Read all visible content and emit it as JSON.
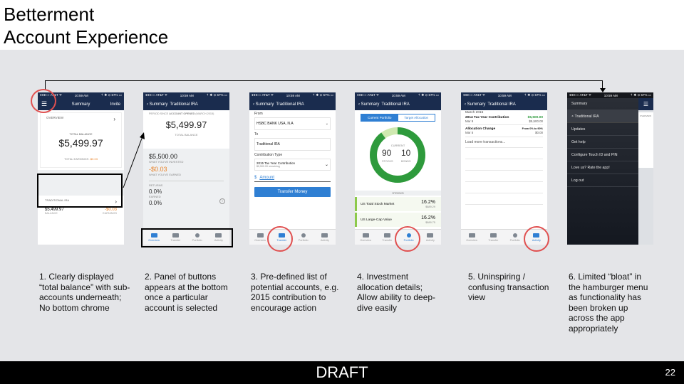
{
  "title": {
    "line1": "Betterment",
    "line2": "Account Experience"
  },
  "footer": {
    "draft": "DRAFT",
    "page": "22"
  },
  "status": {
    "carrier": "●●●○○ AT&T ᯤ",
    "time": "10:59 AM",
    "right": "⇡ ✱ ⊙ 67% ▭"
  },
  "p1": {
    "nav_title": "Summary",
    "nav_invite": "Invite",
    "overview": "OVERVIEW",
    "total_balance_label": "TOTAL BALANCE",
    "total_balance": "$5,499.97",
    "total_earnings_label": "TOTAL EARNINGS",
    "total_earnings": "-$0.03",
    "ira_label": "TRADITIONAL IRA",
    "ira_balance": "$5,499.97",
    "ira_earnings": "-$0.03",
    "balance_label": "BALANCE",
    "earnings_label": "EARNINGS"
  },
  "p2": {
    "nav_back": "Summary",
    "nav_title": "Traditional IRA",
    "period_prefix": "PERIOD SINCE",
    "period_strong": "ACCOUNT OPENED",
    "period_suffix": "(MARCH 2015)",
    "balance": "$5,499.97",
    "balance_label": "TOTAL BALANCE",
    "invested": "$5,500.00",
    "invested_label": "WHAT YOU'VE INVESTED",
    "earned": "-$0.03",
    "earned_label": "WHAT YOU'VE EARNED",
    "returns_label": "RETURNS",
    "earned_pct": "0.0%",
    "earned_pct_label": "EARNED",
    "second_pct": "0.0%"
  },
  "p3": {
    "nav_back": "Summary",
    "nav_title": "Traditional IRA",
    "from_label": "From",
    "from_value": "HSBC BANK USA, N.A",
    "to_label": "To",
    "to_value": "Traditional IRA",
    "ct_label": "Contribution Type",
    "ct_value": "2015 Tax Year Contribution",
    "ct_sub": "$5,500.00 remaining",
    "currency": "$",
    "amount_placeholder": "Amount",
    "transfer_button": "Transfer Money"
  },
  "p4": {
    "nav_back": "Summary",
    "nav_title": "Traditional IRA",
    "seg_current": "Current Portfolio",
    "seg_target": "Target Allocation",
    "current_label": "CURRENT",
    "stocks_value": "90",
    "bonds_value": "10",
    "stocks_label": "STOCKS",
    "bonds_label": "BONDS",
    "stocks_header": "STOCKS",
    "row1_name": "US Total Stock Market",
    "row1_pct": "16.2%",
    "row1_amt": "$889.29",
    "row2_name": "US Large-Cap Value",
    "row2_pct": "16.2%",
    "row2_amt": "$889.75"
  },
  "p5": {
    "nav_back": "Summary",
    "nav_title": "Traditional IRA",
    "month": "March 2015",
    "tx1_title": "2014 Tax Year Contribution",
    "tx1_amount": "$5,500.00",
    "tx1_date": "Mar 9",
    "tx1_value": "$5,500.00",
    "tx2_title": "Allocation Change",
    "tx2_detail": "From 0% to 90%",
    "tx2_date": "Mar 5",
    "tx2_value": "$0.00",
    "load_more": "Load more transactions..."
  },
  "p6": {
    "menu_summary": "Summary",
    "menu_ira": "Traditional IRA",
    "menu_updates": "Updates",
    "menu_help": "Get help",
    "menu_touch": "Configure Touch ID and PIN",
    "menu_rate": "Love us? Rate the app!",
    "menu_logout": "Log out",
    "peek_overview": "OVERVIEW"
  },
  "tabs": [
    "Overview",
    "Transfer",
    "Portfolio",
    "Activity"
  ],
  "captions": [
    "1. Clearly displayed “total balance” with sub-accounts underneath; No bottom chrome",
    "2. Panel of buttons appears at the bottom once a particular account is selected",
    "3. Pre-defined list of potential accounts, e.g. 2015 contribution to encourage action",
    "4. Investment allocation details; Allow ability to deep-dive easily",
    "5. Uninspiring / confusing transaction view",
    "6. Limited “bloat” in the hamburger menu as functionality has been broken up across the app appropriately"
  ],
  "colors": {
    "navy": "#1a2c4e",
    "accent_blue": "#2f7fd3",
    "orange": "#e8832a",
    "green": "#2e9a3c",
    "annotation_red": "#e05050",
    "canvas": "#e4e5e8"
  }
}
